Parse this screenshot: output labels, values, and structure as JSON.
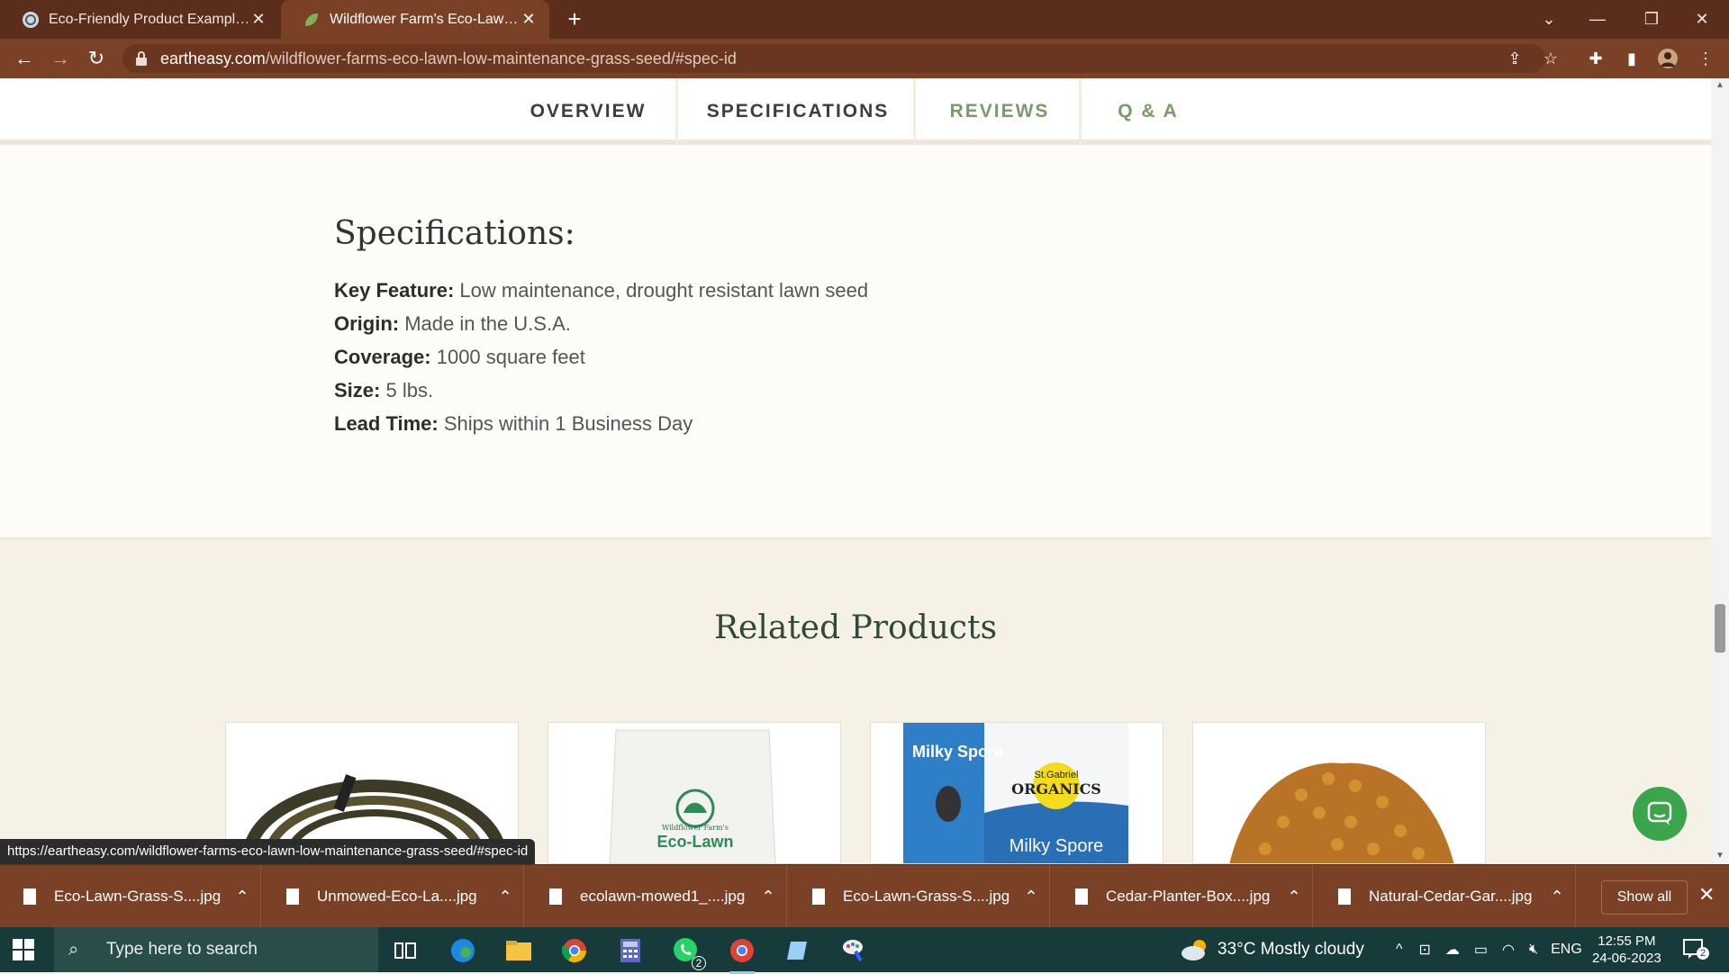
{
  "browser": {
    "tabs": [
      {
        "title": "Eco-Friendly Product Examples",
        "active": false
      },
      {
        "title": "Wildflower Farm's Eco-Lawn Gras",
        "active": true
      }
    ],
    "url_host": "eartheasy.com",
    "url_path": "/wildflower-farms-eco-lawn-low-maintenance-grass-seed/#spec-id",
    "status_url": "https://eartheasy.com/wildflower-farms-eco-lawn-low-maintenance-grass-seed/#spec-id"
  },
  "subnav": {
    "items": [
      "OVERVIEW",
      "SPECIFICATIONS",
      "REVIEWS",
      "Q & A"
    ]
  },
  "specifications": {
    "title": "Specifications:",
    "rows": [
      {
        "label": "Key Feature:",
        "value": "Low maintenance, drought resistant lawn seed"
      },
      {
        "label": "Origin:",
        "value": "Made in the U.S.A."
      },
      {
        "label": "Coverage:",
        "value": "1000 square feet"
      },
      {
        "label": "Size:",
        "value": "5 lbs."
      },
      {
        "label": "Lead Time:",
        "value": "Ships within 1 Business Day"
      }
    ]
  },
  "related": {
    "title": "Related Products",
    "cards": [
      {
        "art": "garden-hose"
      },
      {
        "art": "eco-lawn-bag",
        "text1": "Wildflower Farm's",
        "text2": "Eco-Lawn"
      },
      {
        "art": "milky-spore-box",
        "text1": "Milky Spore",
        "text2": "St.Gabriel",
        "text3": "ORGANICS",
        "text4": "Milky Spore"
      },
      {
        "art": "pellets"
      }
    ]
  },
  "downloads": {
    "items": [
      "Eco-Lawn-Grass-S....jpg",
      "Unmowed-Eco-La....jpg",
      "ecolawn-mowed1_....jpg",
      "Eco-Lawn-Grass-S....jpg",
      "Cedar-Planter-Box....jpg",
      "Natural-Cedar-Gar....jpg"
    ],
    "show_all": "Show all"
  },
  "taskbar": {
    "search_placeholder": "Type here to search",
    "whatsapp_badge": "2",
    "weather": "33°C  Mostly cloudy",
    "lang": "ENG",
    "time": "12:55 PM",
    "date": "24-06-2023",
    "notif_count": "2"
  },
  "colors": {
    "browser_frame": "#5b2e1c",
    "toolbar": "#7a4127",
    "accent_green": "#7a9a6b",
    "chat_green": "#3aa54a"
  }
}
